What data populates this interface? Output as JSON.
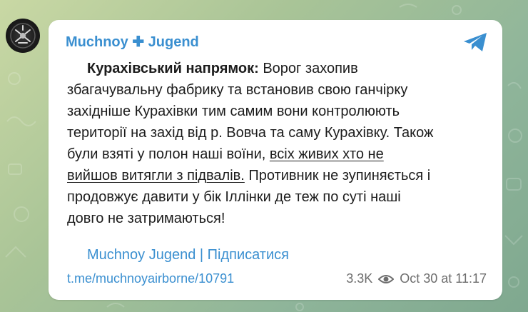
{
  "channel": {
    "name": "Muchnoy ✚ Jugend"
  },
  "message": {
    "bold_prefix": "Курахівський напрямок:",
    "line1_rest": " Ворог захопив",
    "line2": "збагачувальну фабрику та встановив свою ганчірку",
    "line3": "західніше Курахівки тим самим вони контролюють",
    "line4": "території на захід від р. Вовча та саму Курахівку. Також",
    "line5_plain": "були взяті у полон наші воїни, ",
    "line5_underlined": "всіх живих хто не",
    "line6_underlined": "вийшов витягли з підвалів.",
    "line6_rest": " Противник не зупиняється і",
    "line7": "продовжує давити у бік Іллінки де теж по суті наші",
    "line8": "довго не затримаються!"
  },
  "signature": "Muchnoy Jugend | Підписатися",
  "footer": {
    "post_link": "t.me/muchnoyairborne/10791",
    "views": "3.3K",
    "date": "Oct 30 at 11:17"
  },
  "icons": {
    "send": "telegram-send-icon",
    "views": "eye-icon",
    "avatar": "channel-avatar"
  },
  "colors": {
    "accent": "#3a8fd0",
    "meta_text": "#6d6d6d",
    "body_text": "#1c1c1c"
  }
}
